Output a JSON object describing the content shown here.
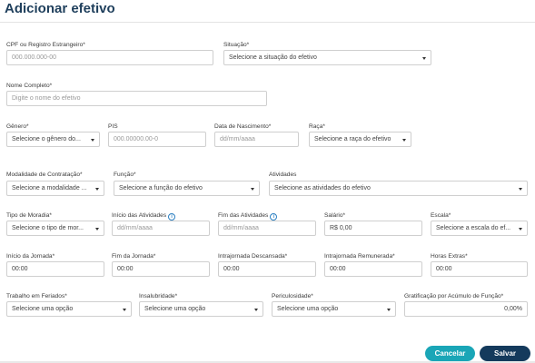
{
  "page": {
    "title": "Adicionar efetivo"
  },
  "form": {
    "cpf": {
      "label": "CPF ou Registro Estrangeiro*",
      "placeholder": "000.000.000-00"
    },
    "situacao": {
      "label": "Situação*",
      "value": "Selecione a situação do efetivo"
    },
    "nome": {
      "label": "Nome Completo*",
      "placeholder": "Digite o nome do efetivo"
    },
    "genero": {
      "label": "Gênero*",
      "value": "Selecione o gênero do..."
    },
    "pis": {
      "label": "PIS",
      "placeholder": "000.00000.00-0"
    },
    "nascimento": {
      "label": "Data de Nascimento*",
      "placeholder": "dd/mm/aaaa"
    },
    "raca": {
      "label": "Raça*",
      "value": "Selecione a raça do efetivo"
    },
    "modalidade": {
      "label": "Modalidade de Contratação*",
      "value": "Selecione a modalidade ..."
    },
    "funcao": {
      "label": "Função*",
      "value": "Selecione a função do efetivo"
    },
    "atividades": {
      "label": "Atividades",
      "value": "Selecione as atividades do efetivo"
    },
    "moradia": {
      "label": "Tipo de Moradia*",
      "value": "Selecione o tipo de mor..."
    },
    "inicio_atividades": {
      "label": "Início das Atividades",
      "placeholder": "dd/mm/aaaa"
    },
    "fim_atividades": {
      "label": "Fim das Atividades",
      "placeholder": "dd/mm/aaaa"
    },
    "salario": {
      "label": "Salário*",
      "value": "R$ 0,00"
    },
    "escala": {
      "label": "Escala*",
      "value": "Selecione a escala do ef..."
    },
    "inicio_jornada": {
      "label": "Início da Jornada*",
      "value": "00:00"
    },
    "fim_jornada": {
      "label": "Fim da Jornada*",
      "value": "00:00"
    },
    "intra_descansada": {
      "label": "Intrajornada Descansada*",
      "value": "00:00"
    },
    "intra_remunerada": {
      "label": "Intrajornada Remunerada*",
      "value": "00:00"
    },
    "horas_extras": {
      "label": "Horas Extras*",
      "value": "00:00"
    },
    "feriados": {
      "label": "Trabalho em Feriados*",
      "value": "Selecione uma opção"
    },
    "insalubridade": {
      "label": "Insalubridade*",
      "value": "Selecione uma opção"
    },
    "periculosidade": {
      "label": "Periculosidade*",
      "value": "Selecione uma opção"
    },
    "gratificacao": {
      "label": "Gratificação por Acúmulo de Função*",
      "value": "0,00%"
    }
  },
  "actions": {
    "cancel": "Cancelar",
    "save": "Salvar"
  },
  "icons": {
    "info": "info-icon",
    "caret": "caret-down-icon"
  },
  "colors": {
    "title": "#1f3f5c",
    "cancel": "#1aa6b7",
    "save": "#143a5c",
    "info": "#2a7fc1"
  }
}
